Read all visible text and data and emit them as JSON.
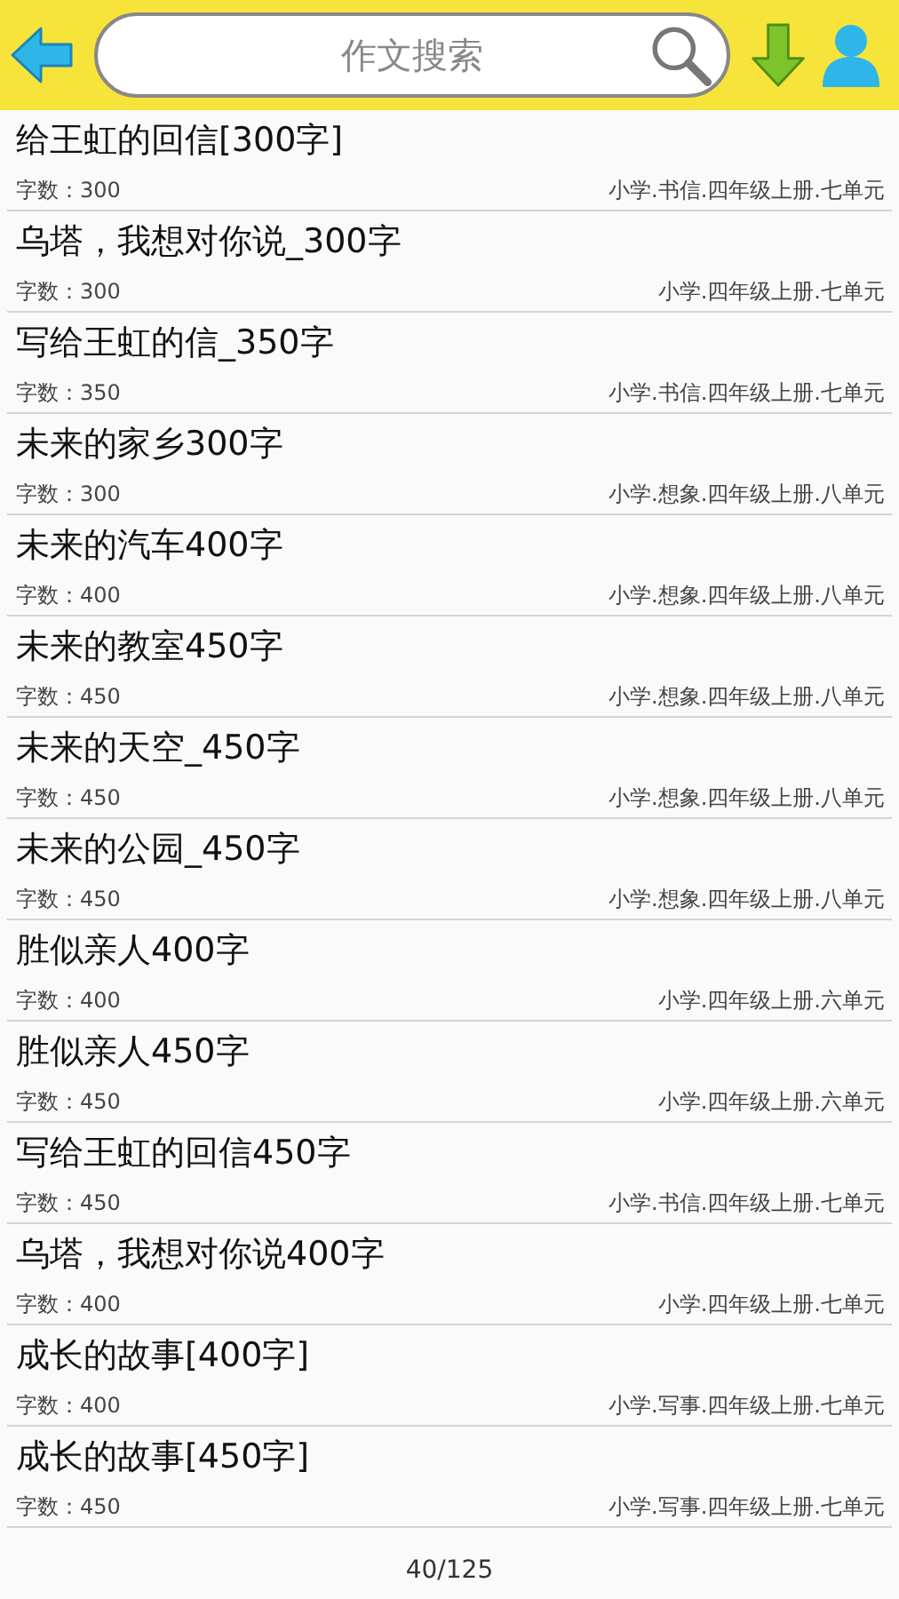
{
  "search": {
    "placeholder": "作文搜索"
  },
  "essays": [
    {
      "title": "给王虹的回信[300字]",
      "count_label": "字数：300",
      "category": "小学.书信.四年级上册.七单元"
    },
    {
      "title": "乌塔，我想对你说_300字",
      "count_label": "字数：300",
      "category": "小学.四年级上册.七单元"
    },
    {
      "title": "写给王虹的信_350字",
      "count_label": "字数：350",
      "category": "小学.书信.四年级上册.七单元"
    },
    {
      "title": "未来的家乡300字",
      "count_label": "字数：300",
      "category": "小学.想象.四年级上册.八单元"
    },
    {
      "title": "未来的汽车400字",
      "count_label": "字数：400",
      "category": "小学.想象.四年级上册.八单元"
    },
    {
      "title": "未来的教室450字",
      "count_label": "字数：450",
      "category": "小学.想象.四年级上册.八单元"
    },
    {
      "title": "未来的天空_450字",
      "count_label": "字数：450",
      "category": "小学.想象.四年级上册.八单元"
    },
    {
      "title": "未来的公园_450字",
      "count_label": "字数：450",
      "category": "小学.想象.四年级上册.八单元"
    },
    {
      "title": "胜似亲人400字",
      "count_label": "字数：400",
      "category": "小学.四年级上册.六单元"
    },
    {
      "title": "胜似亲人450字",
      "count_label": "字数：450",
      "category": "小学.四年级上册.六单元"
    },
    {
      "title": "写给王虹的回信450字",
      "count_label": "字数：450",
      "category": "小学.书信.四年级上册.七单元"
    },
    {
      "title": "乌塔，我想对你说400字",
      "count_label": "字数：400",
      "category": "小学.四年级上册.七单元"
    },
    {
      "title": "成长的故事[400字]",
      "count_label": "字数：400",
      "category": "小学.写事.四年级上册.七单元"
    },
    {
      "title": "成长的故事[450字]",
      "count_label": "字数：450",
      "category": "小学.写事.四年级上册.七单元"
    }
  ],
  "pager": "40/125"
}
